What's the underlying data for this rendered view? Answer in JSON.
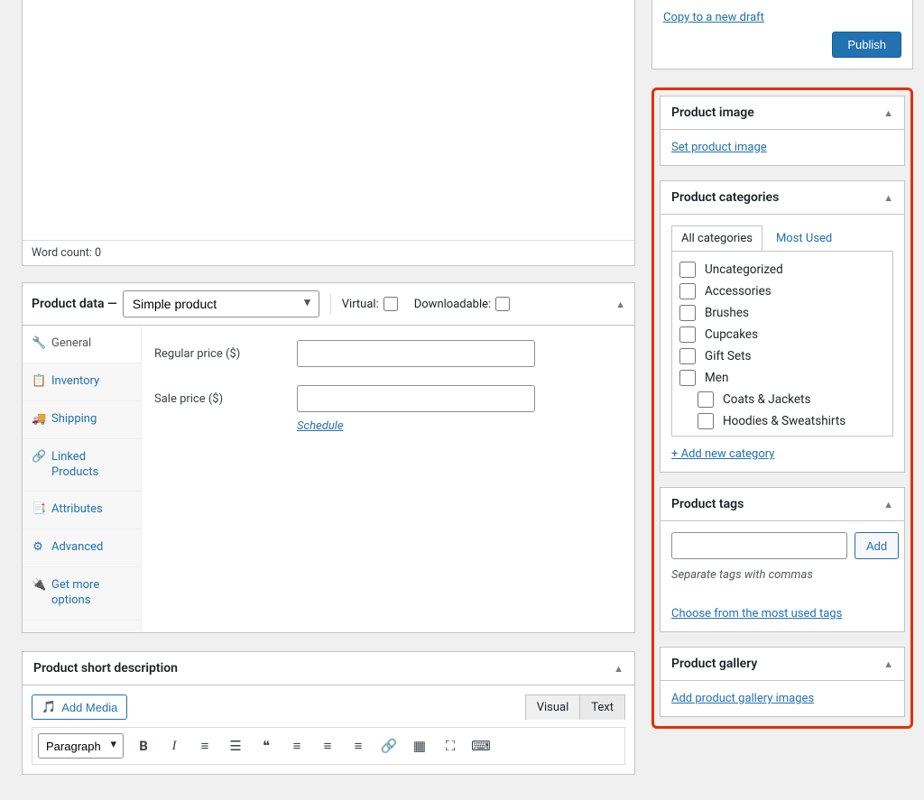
{
  "editor": {
    "word_count_label": "Word count: 0"
  },
  "product_data": {
    "title": "Product data —",
    "type_selected": "Simple product",
    "virtual_label": "Virtual:",
    "downloadable_label": "Downloadable:",
    "tabs": {
      "general": "General",
      "inventory": "Inventory",
      "shipping": "Shipping",
      "linked": "Linked Products",
      "attributes": "Attributes",
      "advanced": "Advanced",
      "more": "Get more options"
    },
    "fields": {
      "regular_price_label": "Regular price ($)",
      "sale_price_label": "Sale price ($)",
      "schedule_label": "Schedule"
    }
  },
  "short_desc": {
    "title": "Product short description",
    "add_media": "Add Media",
    "tab_visual": "Visual",
    "tab_text": "Text",
    "format_selected": "Paragraph"
  },
  "publish": {
    "copy_link": "Copy to a new draft",
    "publish_button": "Publish"
  },
  "product_image": {
    "title": "Product image",
    "link": "Set product image"
  },
  "categories": {
    "title": "Product categories",
    "tab_all": "All categories",
    "tab_most": "Most Used",
    "items": {
      "uncategorized": "Uncategorized",
      "accessories": "Accessories",
      "brushes": "Brushes",
      "cupcakes": "Cupcakes",
      "giftsets": "Gift Sets",
      "men": "Men",
      "coats": "Coats & Jackets",
      "hoodies": "Hoodies & Sweatshirts"
    },
    "add_new": "+ Add new category"
  },
  "tags": {
    "title": "Product tags",
    "add_button": "Add",
    "hint": "Separate tags with commas",
    "choose_link": "Choose from the most used tags"
  },
  "gallery": {
    "title": "Product gallery",
    "link": "Add product gallery images"
  }
}
